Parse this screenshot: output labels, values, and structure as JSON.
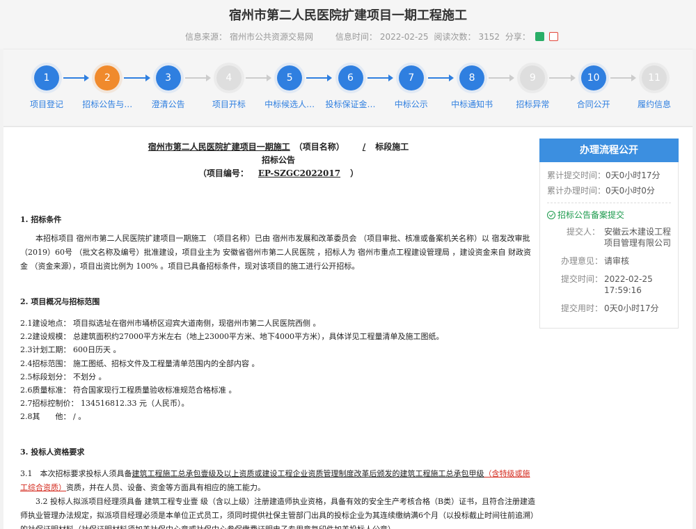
{
  "page": {
    "title": "宿州市第二人民医院扩建项目一期工程施工",
    "source_label": "信息来源：",
    "source": "宿州市公共资源交易网",
    "time_label": "信息时间：",
    "time": "2022-02-25",
    "views_label": "阅读次数：",
    "views": "3152",
    "share_label": "分享："
  },
  "steps": [
    {
      "num": "1",
      "label": "项目登记",
      "state": "done"
    },
    {
      "num": "2",
      "label": "招标公告与…",
      "state": "current"
    },
    {
      "num": "3",
      "label": "澄清公告",
      "state": "done"
    },
    {
      "num": "4",
      "label": "项目开标",
      "state": "pending"
    },
    {
      "num": "5",
      "label": "中标候选人…",
      "state": "done"
    },
    {
      "num": "6",
      "label": "投标保证金…",
      "state": "done"
    },
    {
      "num": "7",
      "label": "中标公示",
      "state": "done"
    },
    {
      "num": "8",
      "label": "中标通知书",
      "state": "done"
    },
    {
      "num": "9",
      "label": "招标异常",
      "state": "pending"
    },
    {
      "num": "10",
      "label": "合同公开",
      "state": "done"
    },
    {
      "num": "11",
      "label": "履约信息",
      "state": "pending"
    }
  ],
  "doc": {
    "head1a": "宿州市第二人民医院扩建项目一期施工",
    "head1b": "（项目名称）",
    "head1c": "/",
    "head1d": "标段施工",
    "head2": "招标公告",
    "head3a": "（项目编号：",
    "head3b": "EP-SZGC2022017",
    "head3c": "）",
    "s1_title": "1. 招标条件",
    "s1_p": "本招标项目 宿州市第二人民医院扩建项目一期施工 （项目名称）已由 宿州市发展和改革委员会 （项目审批、核准或备案机关名称）以 宿发改审批（2019）60号 （批文名称及编号）批准建设，项目业主为 安徽省宿州市第二人民医院 ，招标人为 宿州市重点工程建设管理局 ，建设资金来自 财政资金 （资金来源），项目出资比例为 100% 。项目已具备招标条件，现对该项目的施工进行公开招标。",
    "s2_title": "2. 项目概况与招标范围",
    "s2_items": [
      "2.1建设地点： 项目拟选址在宿州市埇桥区迎宾大道南侧，现宿州市第二人民医院西侧 。",
      "2.2建设规模： 总建筑面积约27000平方米左右（地上23000平方米、地下4000平方米），具体详见工程量清单及施工图纸。",
      "2.3计划工期： 600日历天 。",
      "2.4招标范围： 施工图纸、招标文件及工程量清单范围内的全部内容 。",
      "2.5标段划分： 不划分 。",
      "2.6质量标准： 符合国家现行工程质量验收标准规范合格标准 。",
      "2.7招标控制价： 134516812.33 元（人民币）。",
      "2.8其　　他： / 。"
    ],
    "s3_title": "3. 投标人资格要求",
    "s3_p1a": "3.1　本次招标要求投标人须具备",
    "s3_p1b": "建筑工程施工总承包壹级及以上资质或建设工程企业资质管理制度改革后颁发的建筑工程施工总承包甲级",
    "s3_p1c": "（含特级或施工综合资质）",
    "s3_p1d": "资质，并在人员、设备、资金等方面具有相应的施工能力。",
    "s3_p2": "3.2 投标人拟派项目经理须具备 建筑工程专业壹 级（含以上级）注册建造师执业资格，具备有效的安全生产考核合格（B类）证书，且符合注册建造师执业管理办法规定，拟派项目经理必须是本单位正式员工，须同时提供社保主管部门出具的投标企业为其连续缴纳满6个月（以投标截止时间往前追溯）的社保证明材料（社保证明材料须加盖社保中心章或社保中心参保缴费证明电子专用章复印件加盖投标人公章）。"
  },
  "side": {
    "title": "办理流程公开",
    "total_submit_label": "累计提交时间：",
    "total_submit": "0天0小时17分",
    "total_handle_label": "累计办理时间：",
    "total_handle": "0天0小时0分",
    "status": "招标公告备案提交",
    "submitter_label": "提交人：",
    "submitter": "安徽云木建设工程项目管理有限公司",
    "opinion_label": "办理意见：",
    "opinion": "请审核",
    "submit_time_label": "提交时间：",
    "submit_time": "2022-02-25 17:59:16",
    "submit_used_label": "提交用时：",
    "submit_used": "0天0小时17分"
  }
}
